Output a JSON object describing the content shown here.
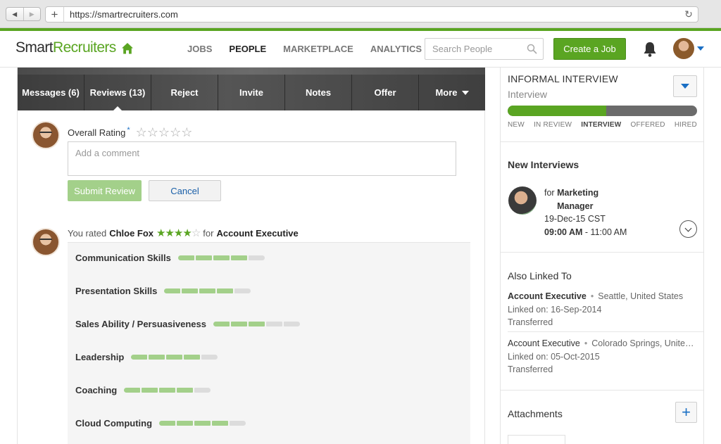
{
  "browser": {
    "url": "https://smartrecruiters.com"
  },
  "header": {
    "logo_left": "Smart",
    "logo_right": "Recruiters",
    "nav": [
      "JOBS",
      "PEOPLE",
      "MARKETPLACE",
      "ANALYTICS"
    ],
    "active_nav": "PEOPLE",
    "search_placeholder": "Search People",
    "create_job_label": "Create a Job",
    "icons": [
      "home-icon",
      "search-icon",
      "bell-icon",
      "chevron-down-icon"
    ],
    "accent_color": "#5aa522",
    "link_color": "#1a6fc4"
  },
  "action_tabs": [
    {
      "label": "Messages (6)"
    },
    {
      "label": "Reviews (13)",
      "active": true
    },
    {
      "label": "Reject"
    },
    {
      "label": "Invite"
    },
    {
      "label": "Notes"
    },
    {
      "label": "Offer"
    },
    {
      "label": "More"
    }
  ],
  "review_form": {
    "rating_label": "Overall Rating",
    "required_mark": "*",
    "stars_empty": "☆☆☆☆☆",
    "comment_placeholder": "Add a comment",
    "submit_label": "Submit Review",
    "cancel_label": "Cancel"
  },
  "review": {
    "prefix": "You rated",
    "candidate": "Chloe Fox",
    "stars_filled": "★★★★",
    "stars_empty": "☆",
    "rating": 4,
    "rating_max": 5,
    "for_text": "for",
    "job": "Account Executive",
    "skills": [
      {
        "name": "Communication Skills",
        "score": 4,
        "max": 5
      },
      {
        "name": "Presentation Skills",
        "score": 4,
        "max": 5
      },
      {
        "name": "Sales Ability / Persuasiveness",
        "score": 3,
        "max": 5
      },
      {
        "name": "Leadership",
        "score": 4,
        "max": 5
      },
      {
        "name": "Coaching",
        "score": 4,
        "max": 5
      },
      {
        "name": "Cloud Computing",
        "score": 4,
        "max": 5
      }
    ]
  },
  "sidebar": {
    "stage_title": "INFORMAL INTERVIEW",
    "stage_subtitle": "Interview",
    "progress_fraction": 0.52,
    "stages": [
      "NEW",
      "IN REVIEW",
      "INTERVIEW",
      "OFFERED",
      "HIRED"
    ],
    "current_stage": "INTERVIEW",
    "new_interviews": {
      "title": "New Interviews",
      "for_text": "for",
      "position": "Marketing Manager",
      "date": "19-Dec-15 CST",
      "start": "09:00 AM",
      "end": "- 11:00 AM"
    },
    "also_linked": {
      "title": "Also Linked To",
      "items": [
        {
          "job": "Account Executive",
          "location": "Seattle, United States",
          "linked": "Linked on: 16-Sep-2014",
          "status": "Transferred",
          "bullet": "•"
        },
        {
          "job": "Account Executive",
          "location": "Colorado Springs, United States",
          "linked": "Linked on: 05-Oct-2015",
          "status": "Transferred",
          "bullet": "•"
        }
      ]
    },
    "attachments": {
      "title": "Attachments",
      "add_label": "+"
    }
  }
}
